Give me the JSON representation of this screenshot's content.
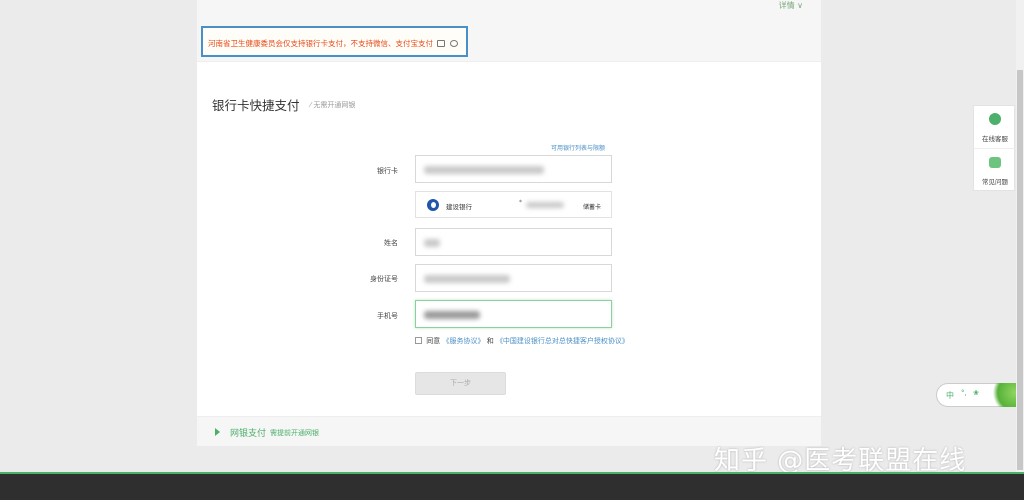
{
  "header": {
    "detail_label": "详情 ∨",
    "notice": "河南省卫生健康委员会仅支持银行卡支付，不支持微信、支付宝支付"
  },
  "form": {
    "title": "银行卡快捷支付",
    "subtitle": "⁄ 无需开通网银",
    "supported_banks_link": "可用银行列表与限额",
    "labels": {
      "card": "银行卡",
      "name": "姓名",
      "id": "身份证号",
      "phone": "手机号"
    },
    "bank": {
      "name": "建设银行",
      "masked_number": "*",
      "card_type": "储蓄卡"
    },
    "agree_prefix": "同意",
    "agree_link1": "《服务协议》",
    "agree_and": "和",
    "agree_link2": "《中国建设银行总对总快捷客户授权协议》",
    "next_button": "下一步"
  },
  "footer": {
    "title": "网银支付",
    "subtitle": "需提前开通网银"
  },
  "side_panel": {
    "customer_service": "在线客服",
    "faq": "常见问题"
  },
  "ime": {
    "mode": "中",
    "sym1": "°,",
    "sym2": "❀"
  },
  "watermark": "知乎 @医考联盟在线"
}
